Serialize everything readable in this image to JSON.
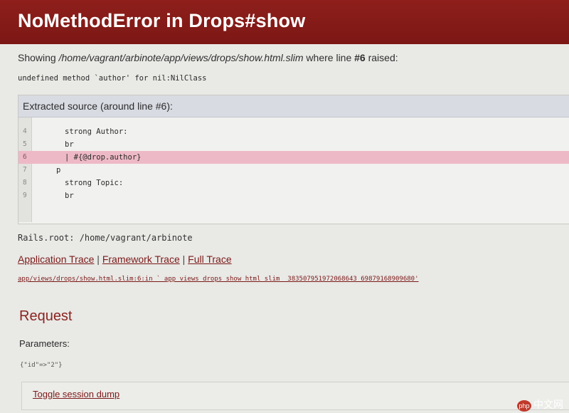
{
  "header": {
    "title": "NoMethodError in Drops#show"
  },
  "showing": {
    "prefix": "Showing ",
    "path": "/home/vagrant/arbinote/app/views/drops/show.html.slim",
    "middle": " where line ",
    "line": "#6",
    "suffix": " raised:"
  },
  "error_message": "undefined method `author' for nil:NilClass",
  "source": {
    "title": "Extracted source (around line #6):",
    "lines": [
      {
        "num": "4",
        "text": "strong Author:",
        "indent": 1
      },
      {
        "num": "5",
        "text": "br",
        "indent": 1
      },
      {
        "num": "6",
        "text": "| #{@drop.author}",
        "indent": 1,
        "highlighted": true
      },
      {
        "num": "7",
        "text": "p",
        "indent": 0
      },
      {
        "num": "8",
        "text": "strong Topic:",
        "indent": 1
      },
      {
        "num": "9",
        "text": "br",
        "indent": 1
      }
    ]
  },
  "rails_root": "Rails.root: /home/vagrant/arbinote",
  "traces": {
    "application": "Application Trace",
    "framework": "Framework Trace",
    "full": "Full Trace",
    "separator": " | "
  },
  "trace_line": "app/views/drops/show.html.slim:6:in `_app_views_drops_show_html_slim__3835079519720686​43_69879168909680'",
  "request": {
    "heading": "Request",
    "parameters_label": "Parameters:",
    "parameters": "{\"id\"=>\"2\"}"
  },
  "session": {
    "toggle_label": "Toggle session dump"
  },
  "watermark": {
    "badge": "php",
    "text": "中文网"
  },
  "colors": {
    "header": "#8e1f1b",
    "link": "#7b1a18",
    "highlight": "#eeb9c6"
  }
}
